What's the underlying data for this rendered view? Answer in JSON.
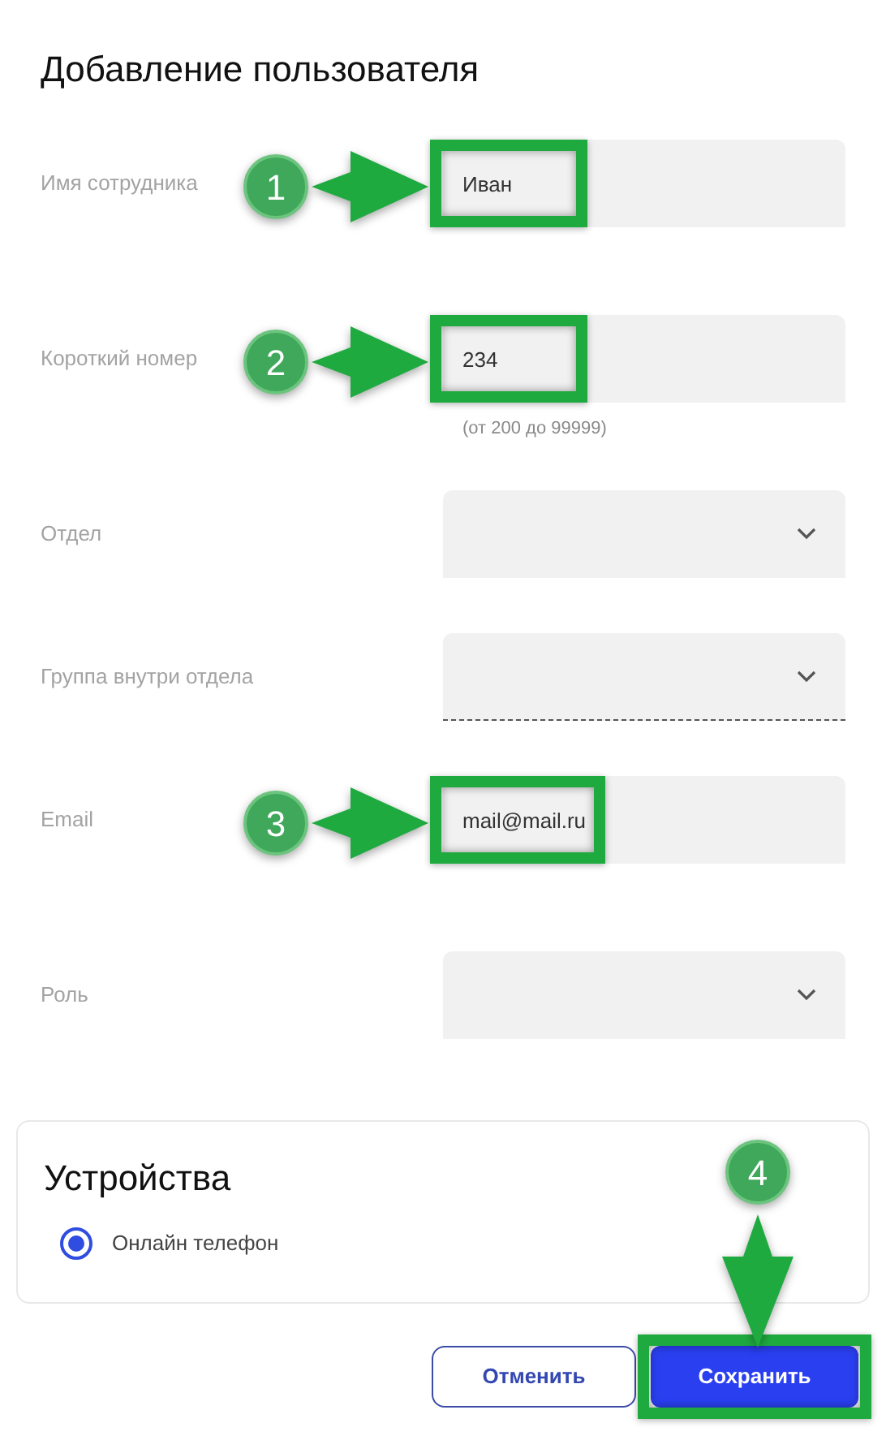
{
  "title": "Добавление пользователя",
  "fields": [
    {
      "kind": "text",
      "label": "Имя сотрудника",
      "value": "Иван",
      "annotation": "1"
    },
    {
      "kind": "text",
      "label": "Короткий номер",
      "value": "234",
      "hint": "(от 200 до 99999)",
      "annotation": "2"
    },
    {
      "kind": "select",
      "label": "Отдел",
      "focused": false
    },
    {
      "kind": "select",
      "label": "Группа внутри отдела",
      "focused": true
    },
    {
      "kind": "text",
      "label": "Email",
      "value": "mail@mail.ru",
      "annotation": "3"
    },
    {
      "kind": "select",
      "label": "Роль",
      "focused": false
    }
  ],
  "devices": {
    "title": "Устройства",
    "options": [
      {
        "label": "Онлайн телефон",
        "selected": true
      }
    ]
  },
  "buttons": [
    {
      "kind": "secondary",
      "label": "Отменить"
    },
    {
      "kind": "primary",
      "label": "Сохранить",
      "annotation": "4"
    }
  ]
}
